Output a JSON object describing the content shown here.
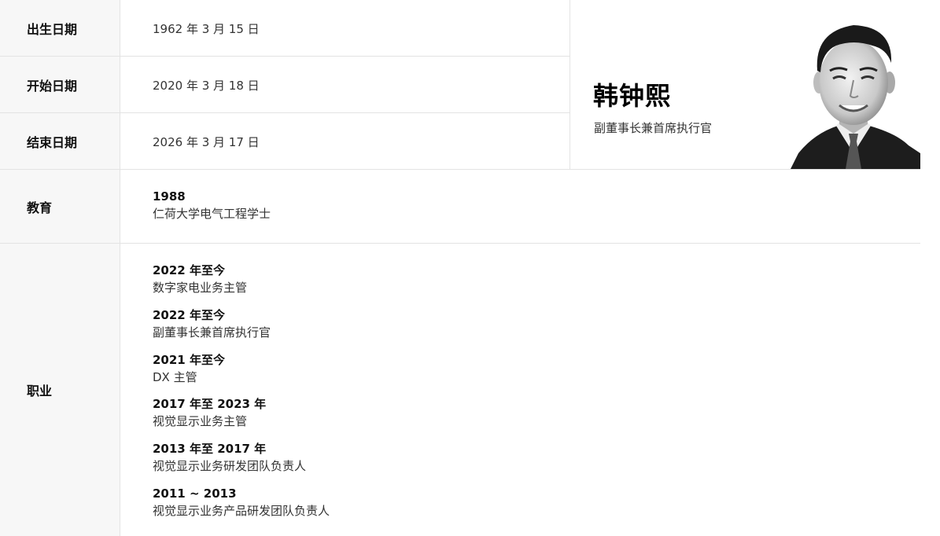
{
  "rows": {
    "birth": {
      "label": "出生日期",
      "value": "1962 年 3 月 15 日"
    },
    "start": {
      "label": "开始日期",
      "value": "2020 年 3 月 18 日"
    },
    "end": {
      "label": "结束日期",
      "value": "2026 年 3 月 17 日"
    }
  },
  "profile": {
    "name": "韩钟熙",
    "title": "副董事长兼首席执行官"
  },
  "education": {
    "label": "教育",
    "year": "1988",
    "degree": "仁荷大学电气工程学士"
  },
  "career": {
    "label": "职业",
    "items": [
      {
        "period": "2022 年至今",
        "role": "数字家电业务主管"
      },
      {
        "period": "2022 年至今",
        "role": "副董事长兼首席执行官"
      },
      {
        "period": "2021 年至今",
        "role": "DX 主管"
      },
      {
        "period": "2017 年至 2023 年",
        "role": "视觉显示业务主管"
      },
      {
        "period": "2013 年至 2017 年",
        "role": "视觉显示业务研发团队负责人"
      },
      {
        "period": "2011 ~ 2013",
        "role": "视觉显示业务产品研发团队负责人"
      }
    ]
  }
}
